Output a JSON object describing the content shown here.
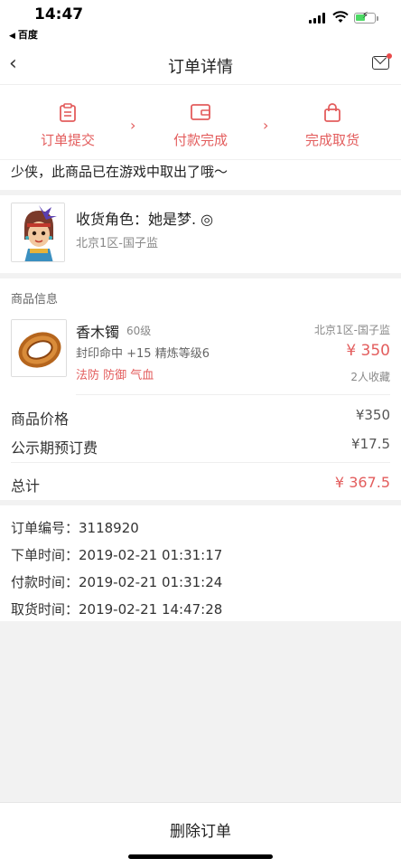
{
  "status_bar": {
    "time": "14:47",
    "back_app": "百度",
    "battery_color": "#4cd964"
  },
  "nav": {
    "title": "订单详情",
    "back_icon": "chevron-left-icon",
    "mail_icon": "mail-icon",
    "badge_color": "#e94b4b"
  },
  "steps": [
    {
      "label": "订单提交",
      "icon": "clipboard-icon"
    },
    {
      "label": "付款完成",
      "icon": "wallet-icon"
    },
    {
      "label": "完成取货",
      "icon": "bag-icon"
    }
  ],
  "accent_color": "#e35d5d",
  "notice": "少侠，此商品已在游戏中取出了哦～",
  "recipient": {
    "role_label": "收货角色：她是梦.  ◎",
    "server": "北京1区-国子监"
  },
  "goods": {
    "section_title": "商品信息",
    "name": "香木镯",
    "level": "60级",
    "attrs": "封印命中 +15 精炼等级6",
    "tags": "法防 防御 气血",
    "server": "北京1区-国子监",
    "price": "¥ 350",
    "favorites": "2人收藏",
    "price_row": {
      "label": "商品价格",
      "value": "¥350"
    },
    "fee_row": {
      "label": "公示期预订费",
      "value": "¥17.5"
    },
    "total_row": {
      "label": "总计",
      "value": "¥ 367.5"
    }
  },
  "order": {
    "number": "订单编号：3118920",
    "placed": "下单时间：2019-02-21 01:31:17",
    "paid": "付款时间：2019-02-21 01:31:24",
    "picked": "取货时间：2019-02-21 14:47:28"
  },
  "bottom": {
    "delete_label": "删除订单"
  }
}
